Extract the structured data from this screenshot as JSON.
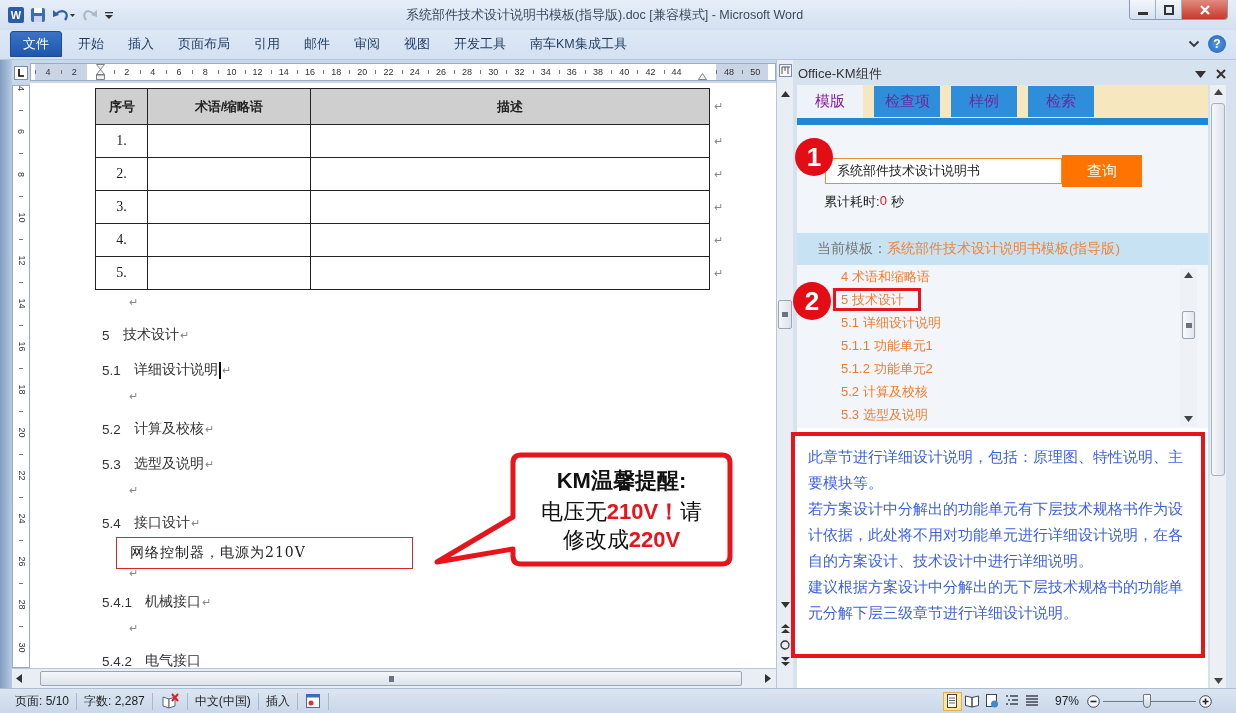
{
  "window": {
    "title": "系统部件技术设计说明书模板(指导版).doc [兼容模式] - Microsoft Word",
    "logo": "W",
    "quick_access": [
      {
        "kind": "save",
        "disabled": false
      },
      {
        "kind": "undo",
        "disabled": false
      },
      {
        "kind": "redo",
        "disabled": true
      },
      {
        "kind": "customize",
        "disabled": false
      }
    ]
  },
  "ribbon": {
    "file_tab": "文件",
    "tabs": [
      {
        "label": "开始",
        "selected": false
      },
      {
        "label": "插入",
        "selected": false
      },
      {
        "label": "页面布局",
        "selected": false
      },
      {
        "label": "引用",
        "selected": false
      },
      {
        "label": "邮件",
        "selected": false
      },
      {
        "label": "审阅",
        "selected": false
      },
      {
        "label": "视图",
        "selected": false
      },
      {
        "label": "开发工具",
        "selected": false
      },
      {
        "label": "南车KM集成工具",
        "selected": false
      }
    ],
    "help": "?"
  },
  "ruler": {
    "marks": [
      {
        "kind": "number",
        "label": "4"
      },
      {
        "kind": "number",
        "label": "2"
      },
      {
        "kind": "left-indent"
      },
      {
        "kind": "number",
        "label": "2"
      },
      {
        "kind": "number",
        "label": "4"
      },
      {
        "kind": "number",
        "label": "6"
      },
      {
        "kind": "number",
        "label": "8"
      },
      {
        "kind": "number",
        "label": "10"
      },
      {
        "kind": "number",
        "label": "12"
      },
      {
        "kind": "number",
        "label": "14"
      },
      {
        "kind": "number",
        "label": "16"
      },
      {
        "kind": "number",
        "label": "18"
      },
      {
        "kind": "number",
        "label": "20"
      },
      {
        "kind": "number",
        "label": "22"
      },
      {
        "kind": "number",
        "label": "24"
      },
      {
        "kind": "number",
        "label": "26"
      },
      {
        "kind": "number",
        "label": "28"
      },
      {
        "kind": "number",
        "label": "30"
      },
      {
        "kind": "number",
        "label": "32"
      },
      {
        "kind": "number",
        "label": "34"
      },
      {
        "kind": "number",
        "label": "36"
      },
      {
        "kind": "number",
        "label": "38"
      },
      {
        "kind": "number",
        "label": "40"
      },
      {
        "kind": "number",
        "label": "42"
      },
      {
        "kind": "number",
        "label": "44"
      },
      {
        "kind": "right-indent"
      },
      {
        "kind": "number",
        "label": "48"
      },
      {
        "kind": "number",
        "label": "50"
      }
    ]
  },
  "vertical_ruler": {
    "labels": [
      "4",
      "6",
      "8",
      "10",
      "12",
      "14",
      "16",
      "18",
      "20",
      "22",
      "24",
      "26",
      "28",
      "30"
    ]
  },
  "document": {
    "table": {
      "columns": [
        "序号",
        "术语/缩略语",
        "描述"
      ],
      "header_mark": "↵",
      "rows": [
        {
          "number": "1.",
          "mark": "↵"
        },
        {
          "number": "2.",
          "mark": "↵"
        },
        {
          "number": "3.",
          "mark": "↵"
        },
        {
          "number": "4.",
          "mark": "↵"
        },
        {
          "number": "5.",
          "mark": "↵"
        }
      ]
    },
    "paragraphs": [
      {
        "kind": "empty",
        "mark": "↵",
        "cursor": false,
        "highlighted": false
      },
      {
        "kind": "heading",
        "number": "5",
        "text": "技术设计",
        "mark": "↵",
        "cursor": false,
        "highlighted": false
      },
      {
        "kind": "heading",
        "number": "5.1",
        "text": "详细设计说明",
        "mark": "↵",
        "cursor": true,
        "highlighted": false
      },
      {
        "kind": "empty",
        "mark": "↵",
        "cursor": false,
        "highlighted": false
      },
      {
        "kind": "heading",
        "number": "5.2",
        "text": "计算及校核",
        "mark": "↵",
        "cursor": false,
        "highlighted": false
      },
      {
        "kind": "heading",
        "number": "5.3",
        "text": "选型及说明",
        "mark": "↵",
        "cursor": false,
        "highlighted": false
      },
      {
        "kind": "empty",
        "mark": "↵",
        "cursor": false,
        "highlighted": false
      },
      {
        "kind": "heading",
        "number": "5.4",
        "text": "接口设计",
        "mark": "↵",
        "cursor": false,
        "highlighted": false
      },
      {
        "kind": "body",
        "text": "网络控制器，电源为210V",
        "cursor": false,
        "highlighted": true
      },
      {
        "kind": "empty",
        "mark": "↵",
        "cursor": false,
        "highlighted": false
      },
      {
        "kind": "heading",
        "number": "5.4.1",
        "text": "机械接口",
        "mark": "↵",
        "cursor": false,
        "highlighted": false
      },
      {
        "kind": "empty",
        "mark": "↵",
        "cursor": false,
        "highlighted": false
      },
      {
        "kind": "heading",
        "number": "5.4.2",
        "text": "电气接口",
        "cursor": false,
        "highlighted": false
      }
    ]
  },
  "callout": {
    "title": "KM温馨提醒:",
    "message": "电压无**210V！**请修改成**220V**"
  },
  "task_pane": {
    "title": "Office-KM组件",
    "tabs": [
      {
        "label": "模版",
        "selected": true
      },
      {
        "label": "检查项",
        "selected": false
      },
      {
        "label": "样例",
        "selected": false
      },
      {
        "label": "检索",
        "selected": false
      }
    ],
    "search": {
      "badge": "1",
      "value": "系统部件技术设计说明书",
      "button": "查询"
    },
    "elapsed": {
      "label": "累计耗时:",
      "value": "0",
      "unit": "秒"
    },
    "current_template": {
      "label": "当前模板：",
      "value": "系统部件技术设计说明书模板(指导版)"
    },
    "outline": {
      "badge": "2",
      "items": [
        {
          "label": "4 术语和缩略语",
          "highlighted": false
        },
        {
          "label": "5 技术设计",
          "highlighted": true
        },
        {
          "label": "5.1 详细设计说明",
          "highlighted": false
        },
        {
          "label": "5.1.1 功能单元1",
          "highlighted": false
        },
        {
          "label": "5.1.2 功能单元2",
          "highlighted": false
        },
        {
          "label": "5.2 计算及校核",
          "highlighted": false
        },
        {
          "label": "5.3 选型及说明",
          "highlighted": false
        }
      ]
    },
    "description": {
      "highlighted": true,
      "paragraphs": [
        "此章节进行详细设计说明，包括：原理图、特性说明、主要模块等。",
        "若方案设计中分解出的功能单元有下层技术规格书作为设计依据，此处将不用对功能单元进行详细设计说明，在各自的方案设计、技术设计中进行详细说明。",
        "建议根据方案设计中分解出的无下层技术规格书的功能单元分解下层三级章节进行详细设计说明。"
      ]
    }
  },
  "status_bar": {
    "page": "页面: 5/10",
    "words": "字数: 2,287",
    "language": "中文(中国)",
    "mode": "插入",
    "views": [
      {
        "kind": "print-layout",
        "selected": true
      },
      {
        "kind": "reading",
        "selected": false
      },
      {
        "kind": "web",
        "selected": false
      },
      {
        "kind": "outline",
        "selected": false
      },
      {
        "kind": "draft",
        "selected": false
      }
    ],
    "zoom": "97%",
    "zoom_slider": {
      "level": 0.47
    }
  }
}
